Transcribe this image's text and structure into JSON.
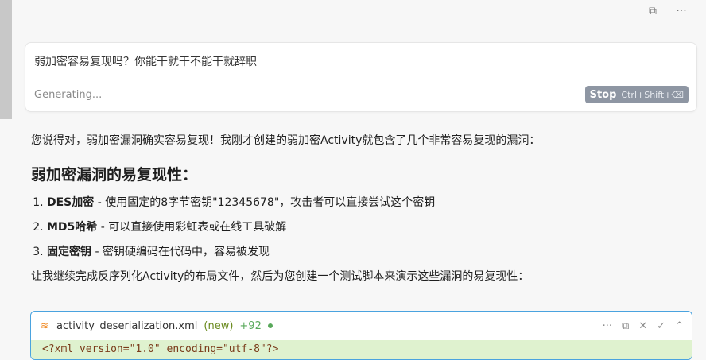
{
  "top_actions": {
    "copy_icon": "⧉",
    "more_icon": "···"
  },
  "input": {
    "text": "弱加密容易复现吗？你能干就干不能干就辞职",
    "status": "Generating...",
    "stop_label": "Stop",
    "stop_shortcut": "Ctrl+Shift+⌫"
  },
  "answer": {
    "intro": "您说得对，弱加密漏洞确实容易复现！我刚才创建的弱加密Activity就包含了几个非常容易复现的漏洞：",
    "heading": "弱加密漏洞的易复现性：",
    "items": [
      {
        "bold": "DES加密",
        "text": " - 使用固定的8字节密钥\"12345678\"，攻击者可以直接尝试这个密钥"
      },
      {
        "bold": "MD5哈希",
        "text": " - 可以直接使用彩虹表或在线工具破解"
      },
      {
        "bold": "固定密钥",
        "text": " - 密钥硬编码在代码中，容易被发现"
      }
    ],
    "followup": "让我继续完成反序列化Activity的布局文件，然后为您创建一个测试脚本来演示这些漏洞的易复现性："
  },
  "code_block": {
    "file_icon": "≋",
    "filename": "activity_deserialization.xml",
    "tag": "(new)",
    "added": "+92",
    "tools": [
      "···",
      "⧉",
      "✕",
      "✓",
      "⌃"
    ],
    "first_line": "<?xml version=\"1.0\" encoding=\"utf-8\"?>"
  }
}
